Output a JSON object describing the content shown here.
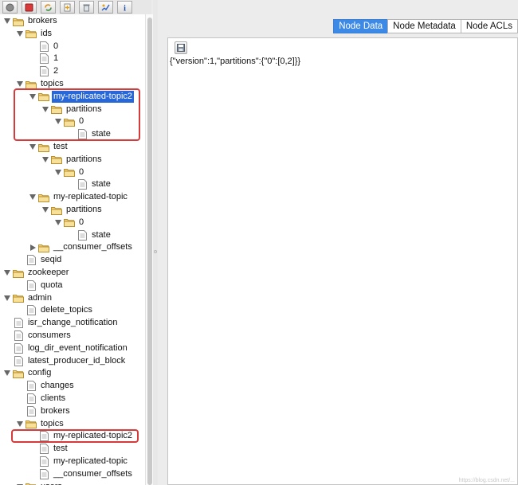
{
  "toolbar": {
    "buttons": [
      {
        "name": "connect-button",
        "icon": "circle-icon"
      },
      {
        "name": "disconnect-button",
        "icon": "stop-icon"
      },
      {
        "name": "refresh-button",
        "icon": "refresh-icon"
      },
      {
        "name": "add-node-button",
        "icon": "add-node-icon"
      },
      {
        "name": "delete-node-button",
        "icon": "trash-icon"
      },
      {
        "name": "settings-button",
        "icon": "settings-icon"
      },
      {
        "name": "about-button",
        "icon": "info-icon"
      }
    ]
  },
  "tree": [
    {
      "label": "brokers",
      "type": "folder",
      "level": 0,
      "expanded": true
    },
    {
      "label": "ids",
      "type": "folder",
      "level": 1,
      "expanded": true
    },
    {
      "label": "0",
      "type": "file",
      "level": 2
    },
    {
      "label": "1",
      "type": "file",
      "level": 2
    },
    {
      "label": "2",
      "type": "file",
      "level": 2
    },
    {
      "label": "topics",
      "type": "folder",
      "level": 1,
      "expanded": true
    },
    {
      "label": "my-replicated-topic2",
      "type": "folder",
      "level": 2,
      "expanded": true,
      "selected": true
    },
    {
      "label": "partitions",
      "type": "folder",
      "level": 3,
      "expanded": true
    },
    {
      "label": "0",
      "type": "folder",
      "level": 4,
      "expanded": true
    },
    {
      "label": "state",
      "type": "file",
      "level": 5
    },
    {
      "label": "test",
      "type": "folder",
      "level": 2,
      "expanded": true
    },
    {
      "label": "partitions",
      "type": "folder",
      "level": 3,
      "expanded": true
    },
    {
      "label": "0",
      "type": "folder",
      "level": 4,
      "expanded": true
    },
    {
      "label": "state",
      "type": "file",
      "level": 5
    },
    {
      "label": "my-replicated-topic",
      "type": "folder",
      "level": 2,
      "expanded": true
    },
    {
      "label": "partitions",
      "type": "folder",
      "level": 3,
      "expanded": true
    },
    {
      "label": "0",
      "type": "folder",
      "level": 4,
      "expanded": true
    },
    {
      "label": "state",
      "type": "file",
      "level": 5
    },
    {
      "label": "__consumer_offsets",
      "type": "folder",
      "level": 2,
      "expanded": false
    },
    {
      "label": "seqid",
      "type": "file",
      "level": 1
    },
    {
      "label": "zookeeper",
      "type": "folder",
      "level": 0,
      "expanded": true
    },
    {
      "label": "quota",
      "type": "file",
      "level": 1
    },
    {
      "label": "admin",
      "type": "folder",
      "level": 0,
      "expanded": true
    },
    {
      "label": "delete_topics",
      "type": "file",
      "level": 1
    },
    {
      "label": "isr_change_notification",
      "type": "file",
      "level": 0
    },
    {
      "label": "consumers",
      "type": "file",
      "level": 0
    },
    {
      "label": "log_dir_event_notification",
      "type": "file",
      "level": 0
    },
    {
      "label": "latest_producer_id_block",
      "type": "file",
      "level": 0
    },
    {
      "label": "config",
      "type": "folder",
      "level": 0,
      "expanded": true
    },
    {
      "label": "changes",
      "type": "file",
      "level": 1
    },
    {
      "label": "clients",
      "type": "file",
      "level": 1
    },
    {
      "label": "brokers",
      "type": "file",
      "level": 1
    },
    {
      "label": "topics",
      "type": "folder",
      "level": 1,
      "expanded": true
    },
    {
      "label": "my-replicated-topic2",
      "type": "file",
      "level": 2
    },
    {
      "label": "test",
      "type": "file",
      "level": 2
    },
    {
      "label": "my-replicated-topic",
      "type": "file",
      "level": 2
    },
    {
      "label": "__consumer_offsets",
      "type": "file",
      "level": 2
    },
    {
      "label": "users",
      "type": "folder",
      "level": 1,
      "expanded": true
    }
  ],
  "tabs": [
    {
      "label": "Node Data",
      "active": true
    },
    {
      "label": "Node Metadata",
      "active": false
    },
    {
      "label": "Node ACLs",
      "active": false
    }
  ],
  "node_data": {
    "text": "{\"version\":1,\"partitions\":{\"0\":[0,2]}}"
  },
  "watermark": "https://blog.csdn.net/..."
}
